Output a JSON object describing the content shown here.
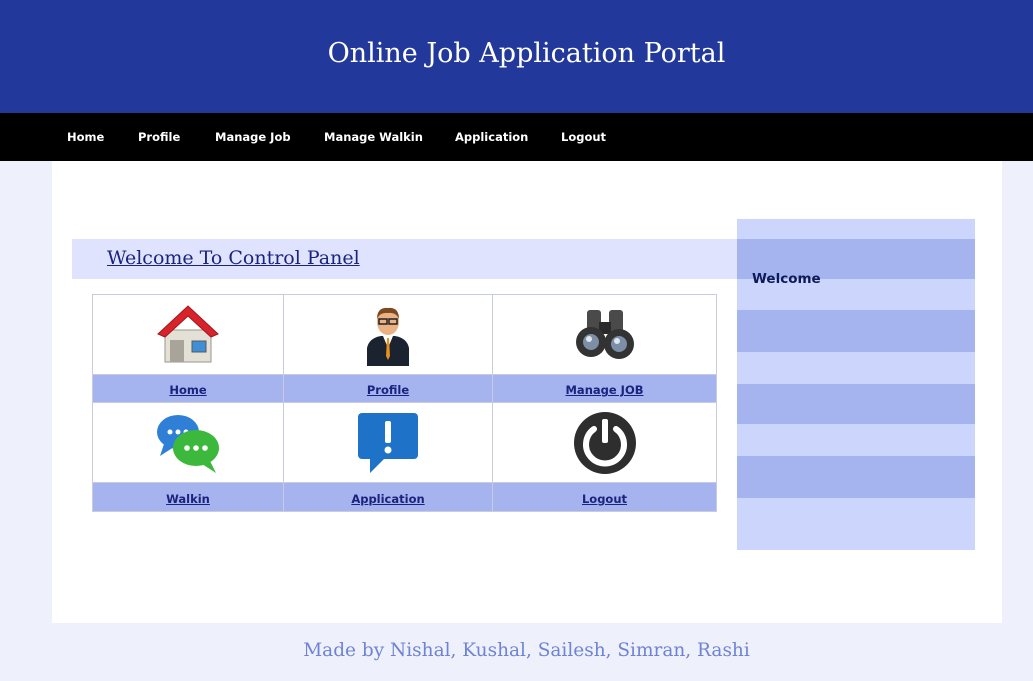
{
  "header": {
    "title": "Online Job Application Portal"
  },
  "nav": {
    "items": [
      {
        "label": "Home"
      },
      {
        "label": "Profile"
      },
      {
        "label": "Manage Job"
      },
      {
        "label": "Manage Walkin"
      },
      {
        "label": "Application"
      },
      {
        "label": "Logout"
      }
    ]
  },
  "main": {
    "heading": "Welcome To Control Panel",
    "tiles": [
      {
        "label": "Home",
        "icon": "house-icon"
      },
      {
        "label": "Profile",
        "icon": "businessman-icon"
      },
      {
        "label": "Manage JOB",
        "icon": "binoculars-icon"
      },
      {
        "label": "Walkin",
        "icon": "chat-bubbles-icon"
      },
      {
        "label": "Application",
        "icon": "exclamation-bubble-icon"
      },
      {
        "label": "Logout",
        "icon": "power-icon"
      }
    ]
  },
  "sidebar": {
    "welcome": "Welcome"
  },
  "footer": {
    "text": "Made by Nishal, Kushal, Sailesh, Simran, Rashi"
  },
  "colors": {
    "header_bg": "#22389a",
    "nav_bg": "#000000",
    "label_row_bg": "#a5b4ef",
    "welcome_bar_bg": "#dfe3fe",
    "footer_text": "#6f83d4"
  }
}
